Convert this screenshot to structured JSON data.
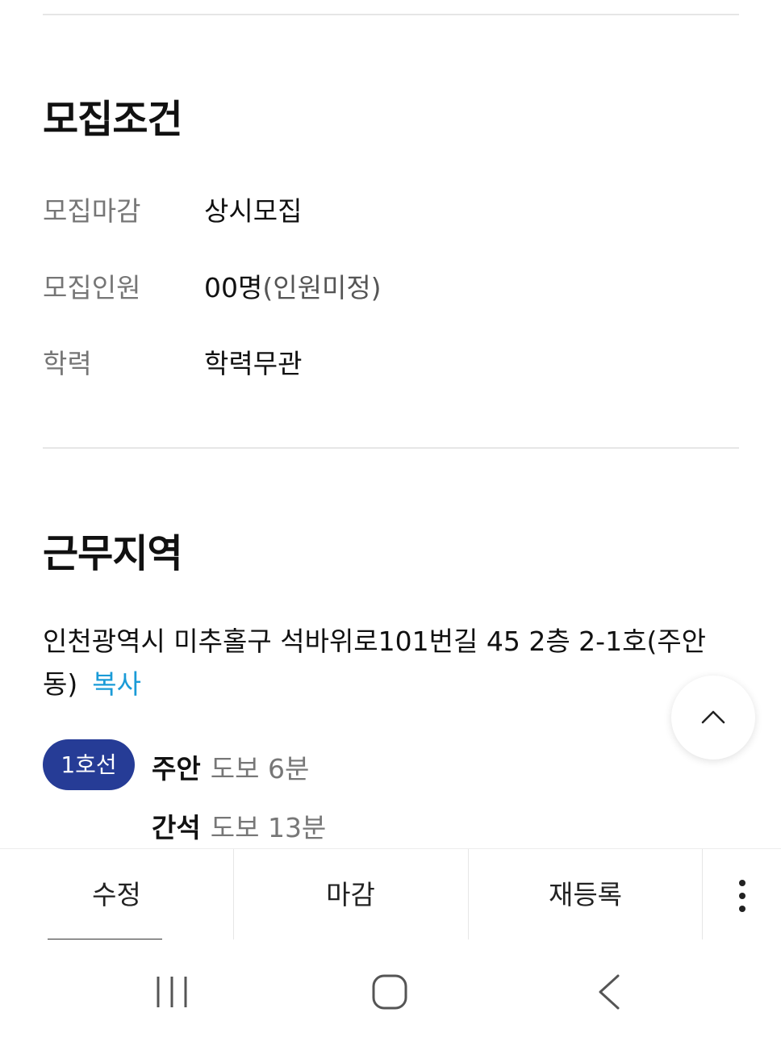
{
  "recruit_conditions": {
    "title": "모집조건",
    "rows": [
      {
        "label": "모집마감",
        "value": "상시모집",
        "sub": ""
      },
      {
        "label": "모집인원",
        "value": "00명",
        "sub": "(인원미정)"
      },
      {
        "label": "학력",
        "value": "학력무관",
        "sub": ""
      }
    ]
  },
  "work_area": {
    "title": "근무지역",
    "address": "인천광역시 미추홀구 석바위로101번길 45 2층 2-1호(주안동)",
    "copy_label": "복사",
    "subway": {
      "line_label": "1호선",
      "line_color": "#263c96",
      "stations": [
        {
          "name": "주안",
          "walk": "도보 6분"
        },
        {
          "name": "간석",
          "walk": "도보 13분"
        }
      ]
    }
  },
  "action_bar": {
    "edit_label": "수정",
    "close_label": "마감",
    "repost_label": "재등록"
  },
  "icons": {
    "scroll_top": "chevron-up-icon",
    "more": "more-vertical-icon",
    "nav_recent": "recent-apps-icon",
    "nav_home": "home-icon",
    "nav_back": "back-icon"
  },
  "colors": {
    "accent_link": "#1a9bd7",
    "line1": "#263c96"
  }
}
